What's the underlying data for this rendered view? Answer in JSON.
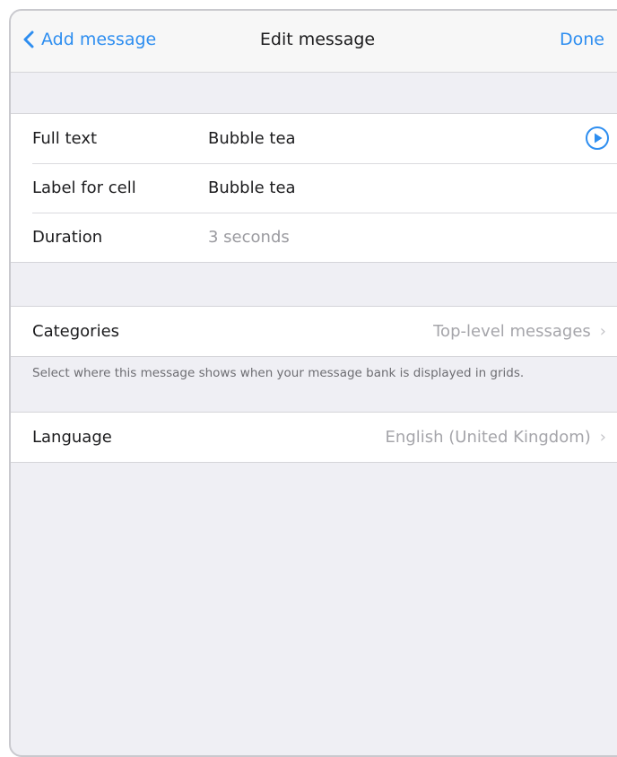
{
  "navbar": {
    "back_label": "Add message",
    "title": "Edit message",
    "done_label": "Done"
  },
  "message_fields": [
    {
      "label": "Full text",
      "value": "Bubble tea"
    },
    {
      "label": "Label for cell",
      "value": "Bubble tea"
    },
    {
      "label": "Duration",
      "value": "3 seconds"
    }
  ],
  "categories": {
    "label": "Categories",
    "value": "Top-level messages",
    "footer": "Select where this message shows when your message bank is displayed in grids."
  },
  "language": {
    "label": "Language",
    "value": "English (United Kingdom)"
  },
  "colors": {
    "accent": "#2e8ef0",
    "background": "#efeff4"
  }
}
